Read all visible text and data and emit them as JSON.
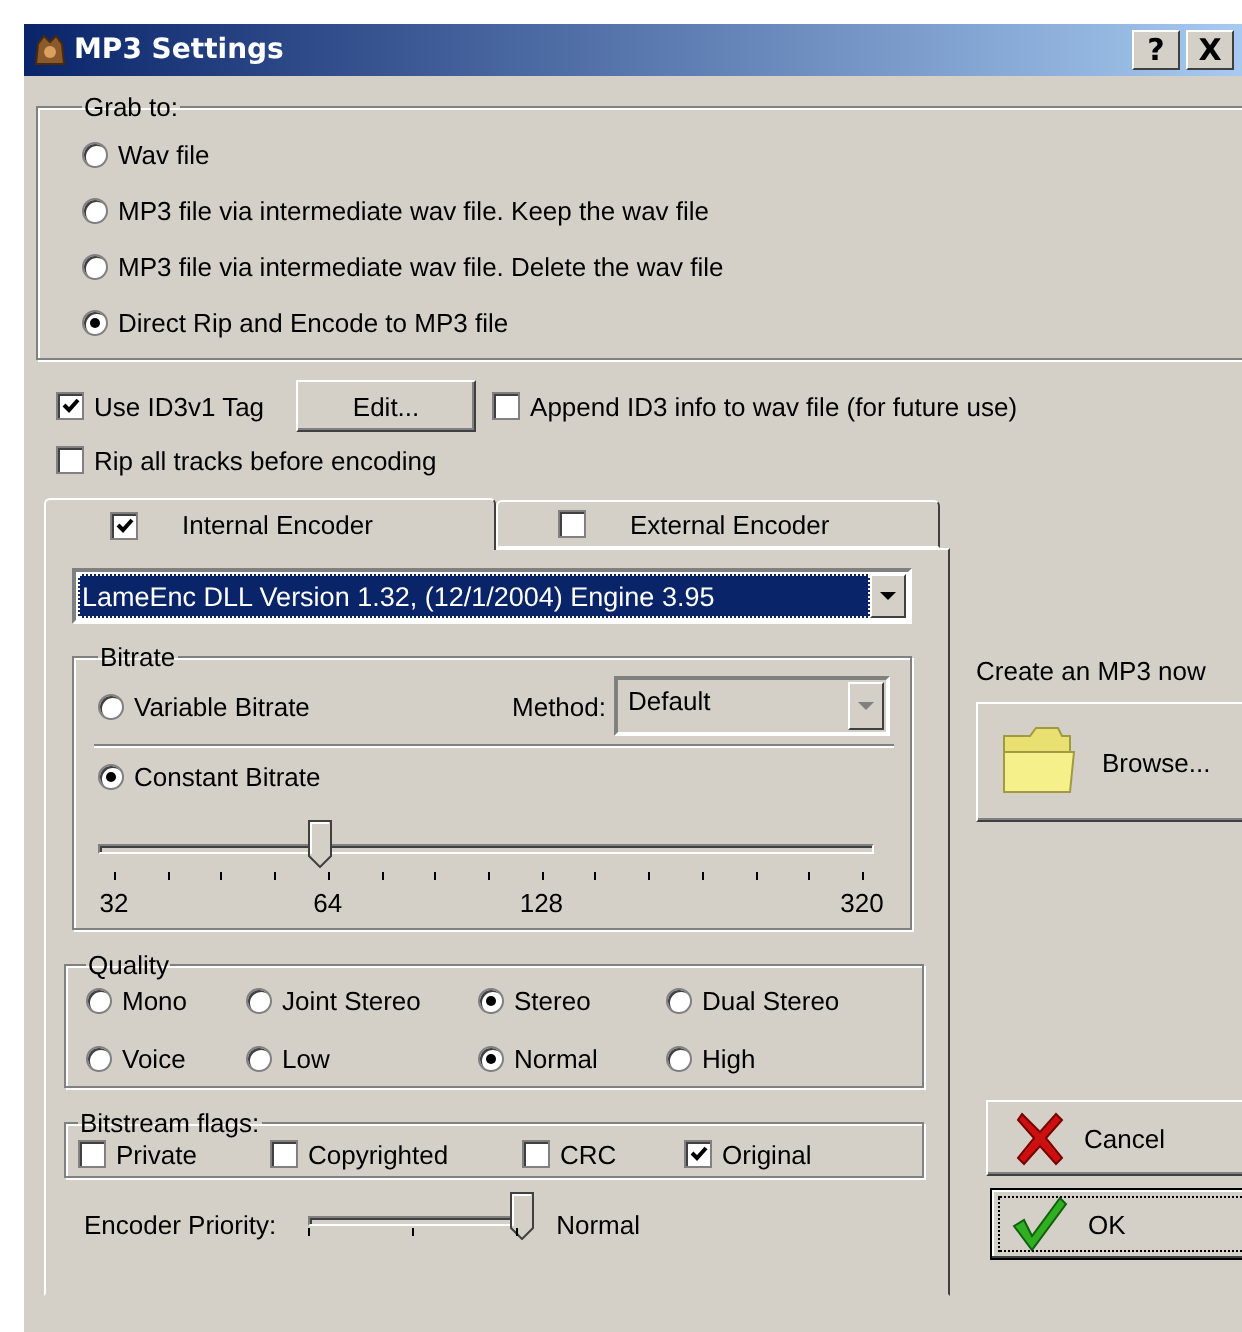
{
  "window": {
    "title": "MP3 Settings",
    "help_button": "?",
    "close_button": "X"
  },
  "grab_to": {
    "label": "Grab to:",
    "options": [
      {
        "label": "Wav file",
        "selected": false
      },
      {
        "label": "MP3 file via intermediate wav file. Keep the wav file",
        "selected": false
      },
      {
        "label": "MP3 file via intermediate wav file. Delete the wav file",
        "selected": false
      },
      {
        "label": "Direct Rip and Encode to MP3 file",
        "selected": true
      }
    ]
  },
  "id3": {
    "use_tag": {
      "label": "Use ID3v1 Tag",
      "checked": true
    },
    "edit_button": "Edit...",
    "append": {
      "label": "Append ID3 info to wav file (for future use)",
      "checked": false
    }
  },
  "rip_all": {
    "label": "Rip all tracks before encoding",
    "checked": false
  },
  "tabs": [
    {
      "label": "Internal Encoder",
      "checked": true,
      "selected": true
    },
    {
      "label": "External Encoder",
      "checked": false,
      "selected": false
    }
  ],
  "encoder_select": {
    "value": "LameEnc DLL Version 1.32, (12/1/2004) Engine 3.95"
  },
  "bitrate": {
    "label": "Bitrate",
    "modes": [
      {
        "label": "Variable Bitrate",
        "selected": false
      },
      {
        "label": "Constant Bitrate",
        "selected": true
      }
    ],
    "method": {
      "label": "Method:",
      "value": "Default",
      "disabled": true
    },
    "slider": {
      "level": 0.286,
      "scale": [
        "32",
        "64",
        "128",
        "320"
      ]
    }
  },
  "quality": {
    "label": "Quality",
    "rows": [
      [
        {
          "label": "Mono",
          "selected": false
        },
        {
          "label": "Joint Stereo",
          "selected": false
        },
        {
          "label": "Stereo",
          "selected": true
        },
        {
          "label": "Dual Stereo",
          "selected": false
        }
      ],
      [
        {
          "label": "Voice",
          "selected": false
        },
        {
          "label": "Low",
          "selected": false
        },
        {
          "label": "Normal",
          "selected": true
        },
        {
          "label": "High",
          "selected": false
        }
      ]
    ]
  },
  "flags": {
    "label": "Bitstream flags:",
    "items": [
      {
        "label": "Private",
        "checked": false
      },
      {
        "label": "Copyrighted",
        "checked": false
      },
      {
        "label": "CRC",
        "checked": false
      },
      {
        "label": "Original",
        "checked": true
      }
    ]
  },
  "priority": {
    "label": "Encoder Priority:",
    "level": 1,
    "reading": "Normal"
  },
  "create": {
    "label": "Create an MP3 now",
    "browse_button": "Browse..."
  },
  "buttons": [
    {
      "label": "Cancel",
      "kind": "cancel",
      "focused": false
    },
    {
      "label": "OK",
      "kind": "ok",
      "focused": true
    }
  ]
}
